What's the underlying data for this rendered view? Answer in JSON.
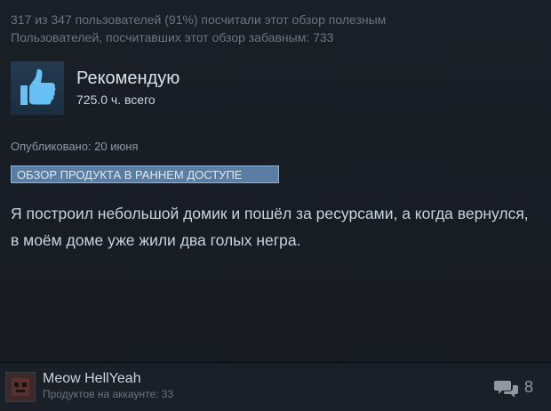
{
  "helpful": {
    "votes_line": "317 из 347 пользователей (91%) посчитали этот обзор полезным",
    "funny_line": "Пользователей, посчитавших этот обзор забавным: 733"
  },
  "recommendation": {
    "title": "Рекомендую",
    "hours": "725.0 ч. всего",
    "icon": "thumbs-up-icon",
    "icon_color": "#67c1f5"
  },
  "posted": "Опубликовано: 20 июня",
  "early_access_badge": "ОБЗОР ПРОДУКТА В РАННЕМ ДОСТУПЕ",
  "review": {
    "text": "Я построил небольшой домик и пошёл за ресурсами, а когда вернулся, в моём доме уже жили два голых негра."
  },
  "author": {
    "name": "Meow HellYeah",
    "products": "Продуктов на аккаунте: 33",
    "avatar_icon": "avatar-icon"
  },
  "comments": {
    "icon": "comment-icon",
    "count": "8"
  },
  "colors": {
    "background": "#171a21",
    "badge": "#5a7ea3",
    "accent": "#67c1f5"
  }
}
